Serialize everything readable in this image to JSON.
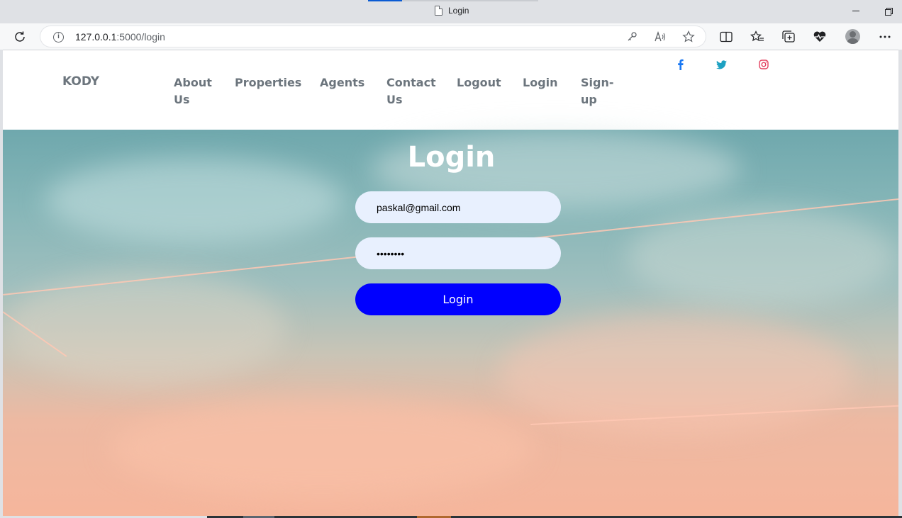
{
  "browser": {
    "tab_title": "Login",
    "url_host": "127.0.0.1",
    "url_rest": ":5000/login",
    "minimize_glyph": "—",
    "restore_glyph": "❐"
  },
  "site": {
    "brand": "KODY",
    "nav": [
      {
        "line1": "About",
        "line2": "Us"
      },
      {
        "line1": "Properties",
        "line2": ""
      },
      {
        "line1": "Agents",
        "line2": ""
      },
      {
        "line1": "Contact",
        "line2": "Us"
      },
      {
        "line1": "Logout",
        "line2": ""
      },
      {
        "line1": "Login",
        "line2": ""
      },
      {
        "line1": "Sign-",
        "line2": "up"
      }
    ],
    "social": {
      "facebook_color": "#1877f2",
      "twitter_color": "#1da1c2",
      "instagram_color": "#e4405f"
    }
  },
  "login": {
    "title": "Login",
    "email_value": "paskal@gmail.com",
    "password_value": "••••••••",
    "button_label": "Login",
    "button_color": "#0000ff"
  }
}
